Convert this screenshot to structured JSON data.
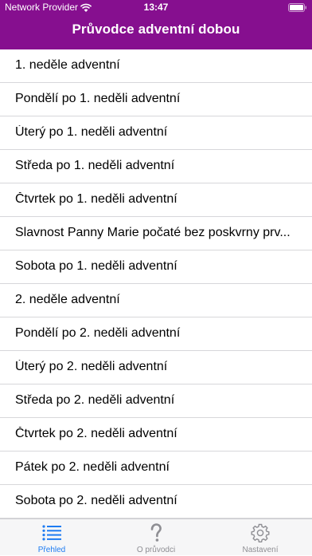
{
  "status_bar": {
    "carrier": "Network Provider",
    "time": "13:47"
  },
  "header": {
    "title": "Průvodce adventní dobou",
    "background_color": "#860f8f"
  },
  "list": {
    "items": [
      {
        "label": "1. neděle adventní"
      },
      {
        "label": "Pondělí po 1. neděli adventní"
      },
      {
        "label": "Úterý po 1. neděli adventní"
      },
      {
        "label": "Středa po 1. neděli adventní"
      },
      {
        "label": "Čtvrtek po 1. neděli adventní"
      },
      {
        "label": "Slavnost Panny Marie počaté bez poskvrny prv..."
      },
      {
        "label": "Sobota po 1. neděli adventní"
      },
      {
        "label": "2. neděle adventní"
      },
      {
        "label": "Pondělí po 2. neděli adventní"
      },
      {
        "label": "Úterý po 2. neděli adventní"
      },
      {
        "label": "Středa po 2. neděli adventní"
      },
      {
        "label": "Čtvrtek po 2. neděli adventní"
      },
      {
        "label": "Pátek po 2. neděli adventní"
      },
      {
        "label": "Sobota po 2. neděli adventní"
      }
    ]
  },
  "tabbar": {
    "tabs": [
      {
        "label": "Přehled",
        "icon": "list-icon",
        "active": true
      },
      {
        "label": "O průvodci",
        "icon": "question-icon",
        "active": false
      },
      {
        "label": "Nastavení",
        "icon": "gear-icon",
        "active": false
      }
    ],
    "active_color": "#1e7cf2",
    "inactive_color": "#8e8e93"
  }
}
